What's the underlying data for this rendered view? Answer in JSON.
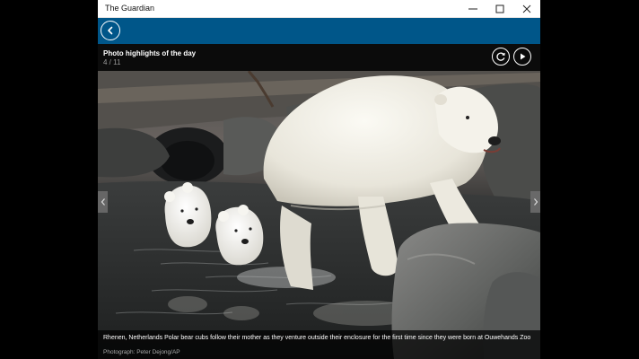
{
  "window": {
    "title": "The Guardian",
    "minimize_icon": "minimize-icon",
    "maximize_icon": "maximize-icon",
    "close_icon": "close-icon"
  },
  "appbar": {
    "accent_color": "#005689",
    "back_icon": "back-arrow-icon"
  },
  "gallery": {
    "title": "Photo highlights of the day",
    "counter": "4 / 11",
    "current": 4,
    "total": 11,
    "refresh_icon": "refresh-icon",
    "play_icon": "play-icon",
    "prev_icon": "chevron-left-icon",
    "next_icon": "chevron-right-icon"
  },
  "photo": {
    "caption": "Rhenen, Netherlands Polar bear cubs follow their mother as they venture outside their enclosure for the first time since they were born at Ouwehands Zoo",
    "credit": "Photograph: Peter Dejong/AP"
  }
}
